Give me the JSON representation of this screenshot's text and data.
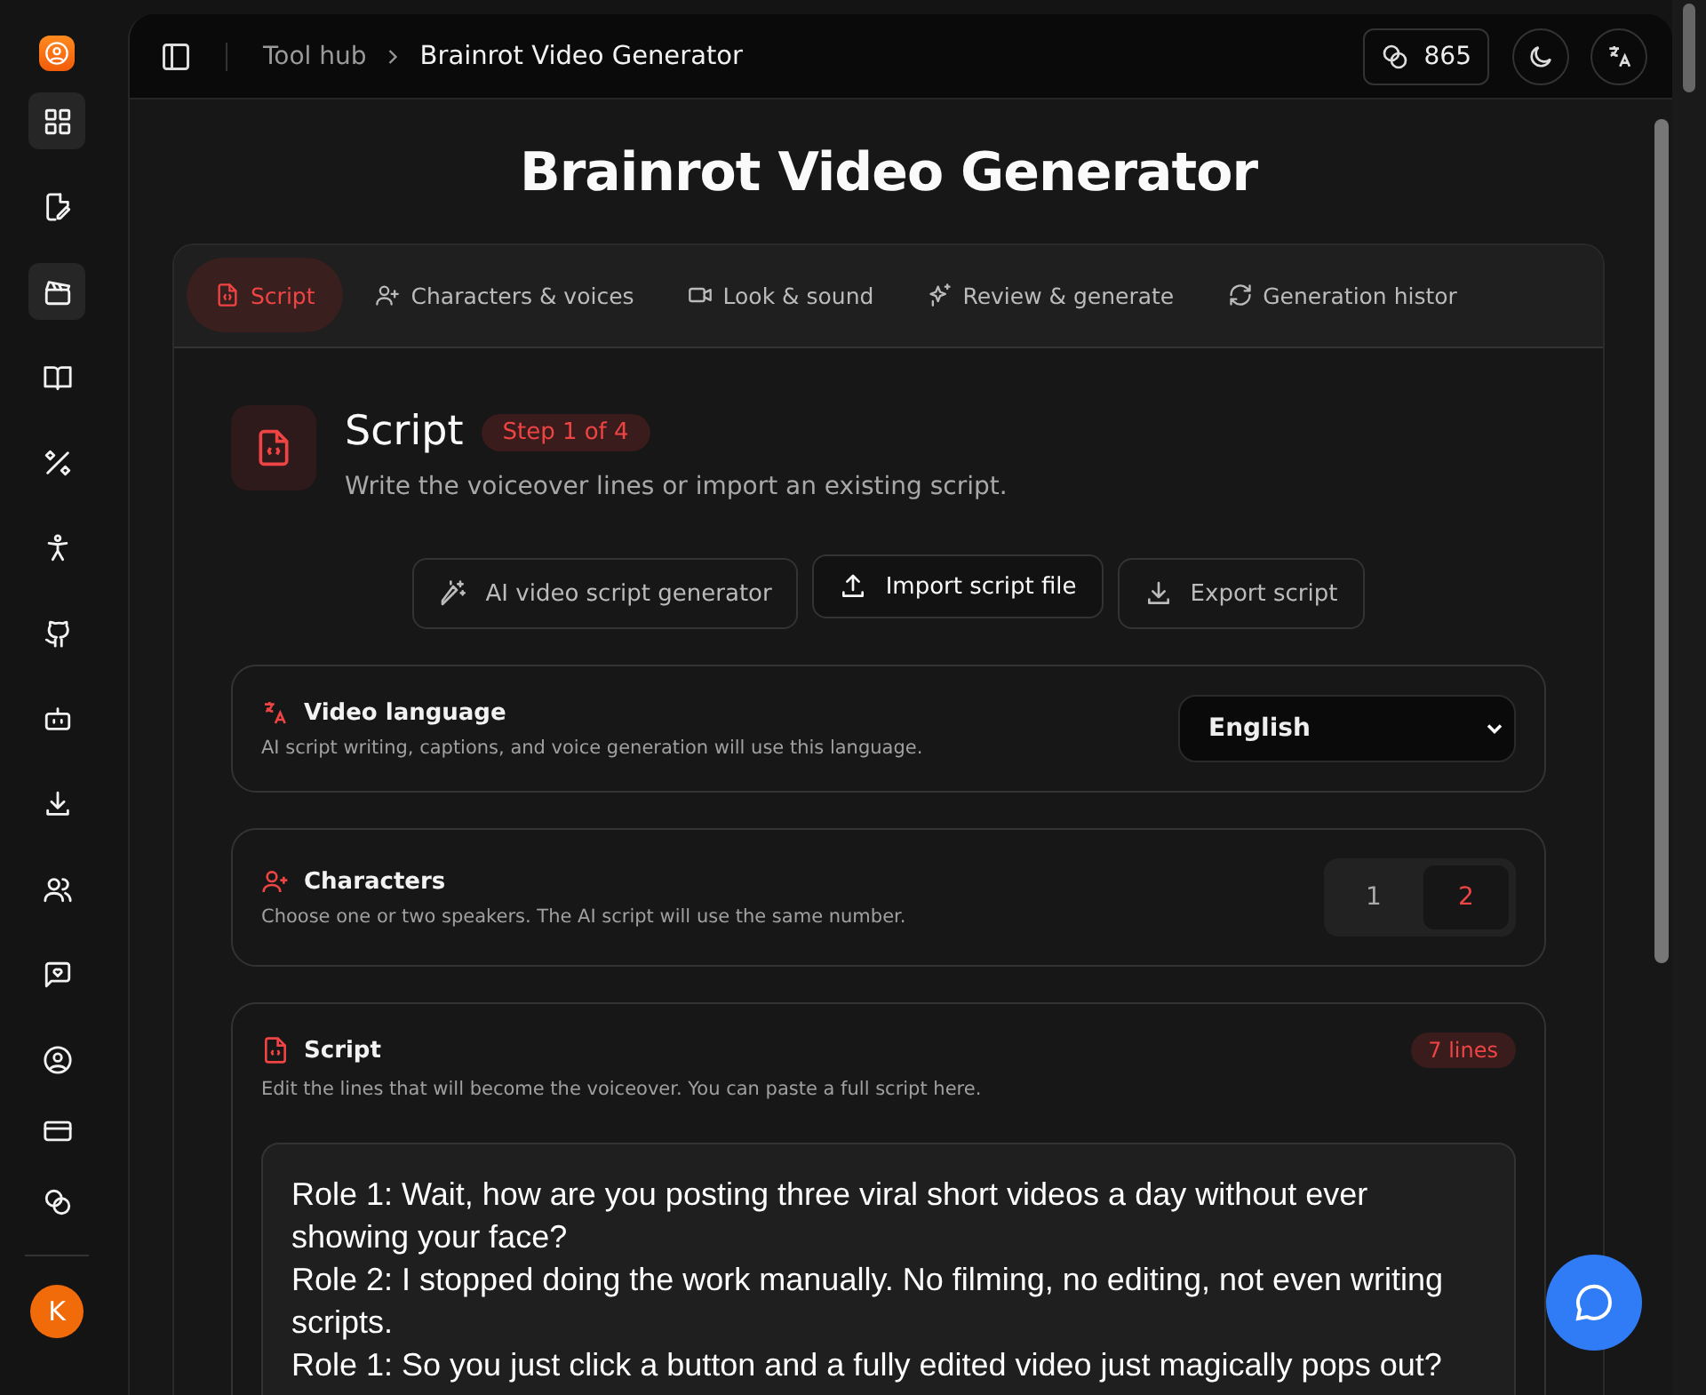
{
  "sidebar": {
    "items": [
      {
        "selected": true
      },
      {
        "selected": false
      },
      {
        "selected": true
      },
      {
        "selected": false
      },
      {
        "selected": false
      },
      {
        "selected": false
      },
      {
        "selected": false
      },
      {
        "selected": false
      },
      {
        "selected": false
      },
      {
        "selected": false
      },
      {
        "selected": false
      },
      {
        "selected": false
      },
      {
        "selected": false
      },
      {
        "selected": false
      }
    ],
    "avatar": "K"
  },
  "breadcrumb": [
    "Tool hub",
    "Brainrot Video Generator"
  ],
  "credits": "865",
  "title": "Brainrot Video Generator",
  "tabs": [
    {
      "label": "Script",
      "selected": true
    },
    {
      "label": "Characters & voices",
      "selected": false
    },
    {
      "label": "Look & sound",
      "selected": false
    },
    {
      "label": "Review & generate",
      "selected": false
    },
    {
      "label": "Generation histor",
      "selected": false
    }
  ],
  "step": {
    "title": "Script",
    "badge": "Step 1 of 4",
    "description": "Write the voiceover lines or import an existing script."
  },
  "actions": [
    {
      "label": "AI video script generator",
      "emphasized": false
    },
    {
      "label": "Import script file",
      "emphasized": true
    },
    {
      "label": "Export script",
      "emphasized": false
    }
  ],
  "language": {
    "title": "Video language",
    "description": "AI script writing, captions, and voice generation will use this language.",
    "value": "English"
  },
  "characters": {
    "title": "Characters",
    "description": "Choose one or two speakers. The AI script will use the same number.",
    "options": [
      {
        "label": "1",
        "selected": false
      },
      {
        "label": "2",
        "selected": true
      }
    ]
  },
  "script": {
    "title": "Script",
    "badge": "7 lines",
    "description": "Edit the lines that will become the voiceover. You can paste a full script here.",
    "value": "Role 1: Wait, how are you posting three viral short videos a day without ever showing your face?\nRole 2: I stopped doing the work manually. No filming, no editing, not even writing scripts.\nRole 1: So you just click a button and a fully edited video just magically pops out?"
  }
}
